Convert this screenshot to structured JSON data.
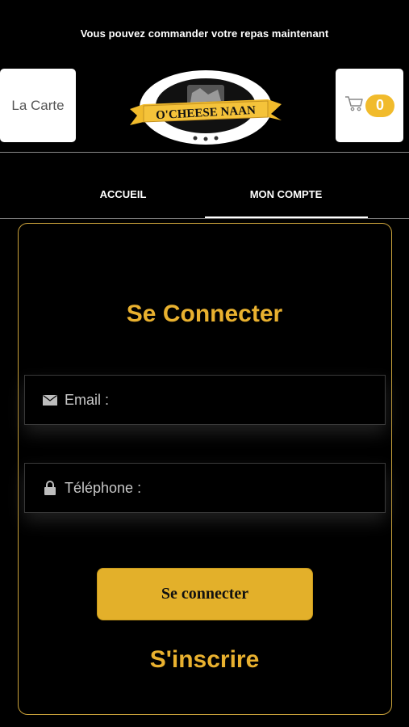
{
  "banner": {
    "text": "Vous pouvez commander votre repas maintenant"
  },
  "header": {
    "carte_label": "La Carte",
    "cart_count": "0",
    "logo_text": "O'CHEESE NAAN"
  },
  "tabs": [
    {
      "label": "ACCUEIL",
      "active": false
    },
    {
      "label": "MON COMPTE",
      "active": true
    }
  ],
  "login": {
    "title": "Se Connecter",
    "email_label": "Email :",
    "phone_label": "Téléphone :",
    "submit_label": "Se connecter",
    "signup_label": "S'inscrire"
  },
  "colors": {
    "accent": "#e9b12f",
    "background": "#000000",
    "card_border": "#c9a13a"
  },
  "icons": [
    "cart-icon",
    "envelope-icon",
    "lock-icon"
  ]
}
